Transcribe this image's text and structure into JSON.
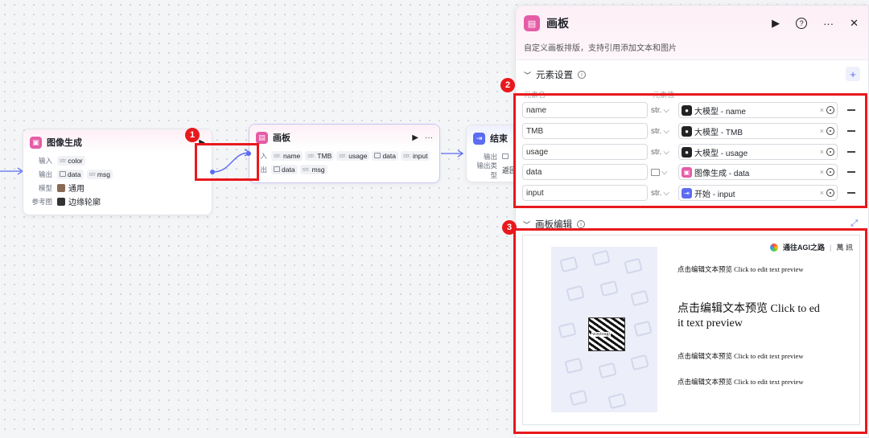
{
  "node_image": {
    "title": "图像生成",
    "rows": [
      {
        "label": "输入",
        "tags": [
          {
            "type": "str",
            "text": "color"
          }
        ]
      },
      {
        "label": "输出",
        "tags": [
          {
            "type": "img",
            "text": "data"
          },
          {
            "type": "str",
            "text": "msg"
          }
        ]
      },
      {
        "label": "模型",
        "value": "通用"
      },
      {
        "label": "参考图",
        "value": "边缘轮廓"
      }
    ]
  },
  "node_canvas": {
    "title": "画板",
    "row1_label": "入",
    "row1_tags": [
      "name",
      "TMB",
      "usage",
      "data",
      "input"
    ],
    "row2_label": "出",
    "row2_tags": [
      "data",
      "msg"
    ]
  },
  "node_end": {
    "title": "结束",
    "row1_label": "输出",
    "row2_label": "输出类型",
    "row2_value": "返回"
  },
  "type_str": "str.",
  "badges": [
    "1",
    "2",
    "3"
  ],
  "panel": {
    "title": "画板",
    "description": "自定义画板排版，支持引用添加文本和图片",
    "section_elements": "元素设置",
    "col_name": "元素名",
    "col_value": "元素值",
    "rows": [
      {
        "name": "name",
        "type": "str.",
        "source_icon": "model-icon",
        "ref": "大模型 - name"
      },
      {
        "name": "TMB",
        "type": "str.",
        "source_icon": "model-icon",
        "ref": "大模型 - TMB"
      },
      {
        "name": "usage",
        "type": "str.",
        "source_icon": "model-icon",
        "ref": "大模型 - usage"
      },
      {
        "name": "data",
        "type": "image",
        "source_icon": "image-gen-icon",
        "ref": "图像生成 - data"
      },
      {
        "name": "input",
        "type": "str.",
        "source_icon": "start-icon",
        "ref": "开始 - input"
      }
    ],
    "section_canvas": "画板编辑",
    "canvas": {
      "brand1": "通往AGI之路",
      "brand2": "萬 訊",
      "qr_label": "waytoagi",
      "text1": "点击编辑文本预览 Click to edit text preview",
      "text2_line1": "点击编辑文本预览 Click to ed",
      "text2_line2": "it text preview",
      "text3": "点击编辑文本预览 Click to edit text preview",
      "text4": "点击编辑文本预览 Click to edit text preview"
    }
  },
  "colors": {
    "accent_red": "#e8191d",
    "port_blue": "#5b6cf2",
    "node_pink": "#e55ca6"
  }
}
